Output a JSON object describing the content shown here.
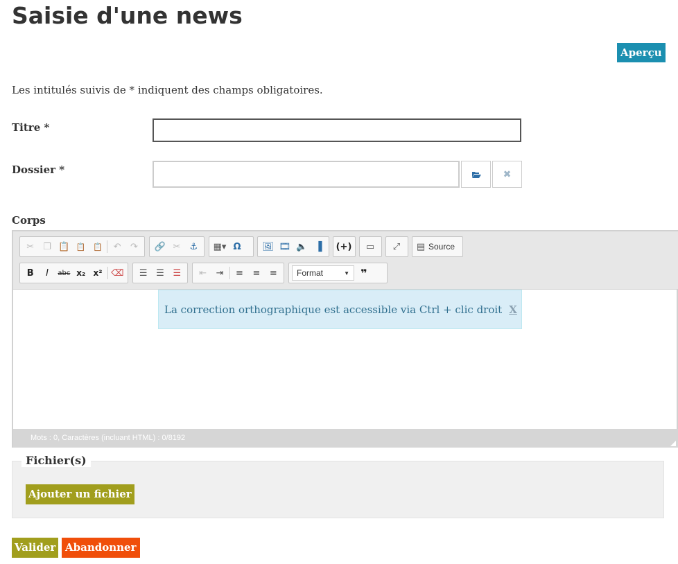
{
  "page": {
    "title": "Saisie d'une news",
    "preview_label": "Aperçu",
    "intro": "Les intitulés suivis de * indiquent des champs obligatoires."
  },
  "form": {
    "titre_label": "Titre *",
    "titre_value": "",
    "dossier_label": "Dossier *",
    "dossier_value": "",
    "corps_label": "Corps"
  },
  "editor": {
    "toolbar_row1": [
      "cut",
      "copy",
      "paste",
      "paste-text",
      "paste-word",
      "undo",
      "redo",
      "link",
      "unlink",
      "anchor",
      "table",
      "special-char",
      "image",
      "video",
      "audio",
      "flash",
      "insert-plugin",
      "templates",
      "maximize"
    ],
    "source_label": "Source",
    "toolbar_row2": [
      "bold",
      "italic",
      "strikethrough",
      "subscript",
      "superscript",
      "remove-format",
      "numbered-list",
      "bulleted-list",
      "checklist",
      "outdent",
      "indent",
      "align-left",
      "align-center",
      "align-right",
      "blockquote"
    ],
    "format_label": "Format",
    "notice_text": "La correction orthographique est accessible via Ctrl + clic droit",
    "notice_close": "X",
    "status_text": "Mots : 0, Caractères (incluant HTML) : 0/8192"
  },
  "files": {
    "legend": "Fichier(s)",
    "add_label": "Ajouter un fichier"
  },
  "actions": {
    "validate_label": "Valider",
    "cancel_label": "Abandonner"
  },
  "colors": {
    "teal": "#1b8fb0",
    "olive": "#a19e1d",
    "orange": "#f04e0a",
    "notice_bg": "#d9edf7"
  }
}
